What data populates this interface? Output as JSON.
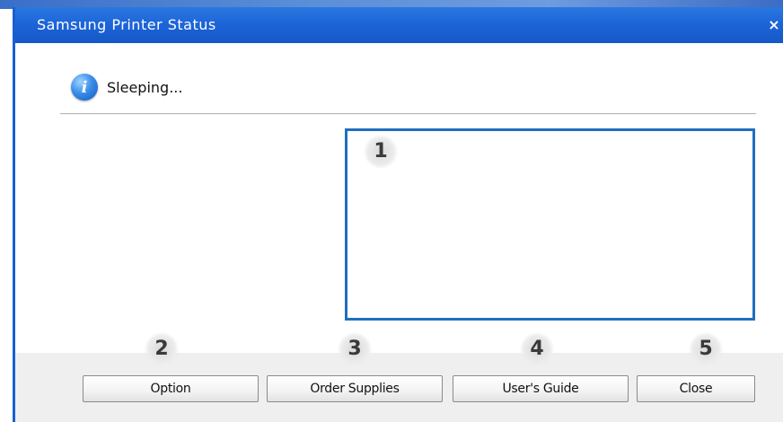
{
  "window": {
    "title": "Samsung Printer Status",
    "close_glyph": "×"
  },
  "status": {
    "icon": "info-icon",
    "icon_glyph": "i",
    "text": "Sleeping..."
  },
  "callouts": {
    "message_area": "1",
    "option": "2",
    "order_supplies": "3",
    "users_guide": "4",
    "close": "5"
  },
  "buttons": {
    "option": "Option",
    "order_supplies": "Order Supplies",
    "users_guide": "User's Guide",
    "close": "Close"
  },
  "colors": {
    "titlebar": "#1d65d8",
    "message_border": "#1f6fbf",
    "footer": "#efefef"
  }
}
